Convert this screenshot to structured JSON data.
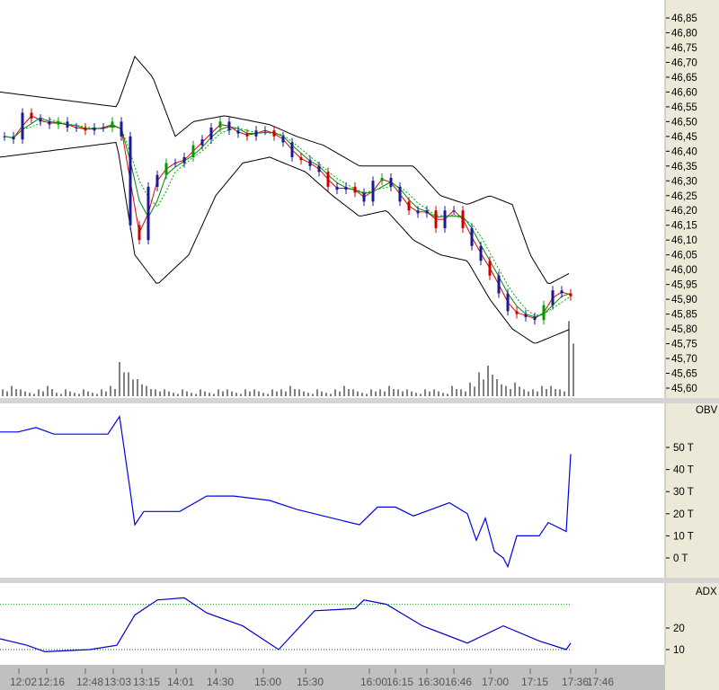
{
  "chart_data": [
    {
      "panel": "price",
      "type": "candlestick",
      "ylim": [
        45.57,
        46.88
      ],
      "y_ticks": [
        "46,85",
        "46,80",
        "46,75",
        "46,70",
        "46,65",
        "46,60",
        "46,55",
        "46,50",
        "46,45",
        "46,40",
        "46,35",
        "46,30",
        "46,25",
        "46,20",
        "46,15",
        "46,10",
        "46,05",
        "46,00",
        "45,95",
        "45,90",
        "45,85",
        "45,80",
        "45,75",
        "45,70",
        "45,65",
        "45,60"
      ],
      "y_tick_values": [
        46.85,
        46.8,
        46.75,
        46.7,
        46.65,
        46.6,
        46.55,
        46.5,
        46.45,
        46.4,
        46.35,
        46.3,
        46.25,
        46.2,
        46.15,
        46.1,
        46.05,
        46.0,
        45.95,
        45.9,
        45.85,
        45.8,
        45.75,
        45.7,
        45.65,
        45.6
      ],
      "closes": [
        46.45,
        46.44,
        46.53,
        46.51,
        46.5,
        46.49,
        46.5,
        46.48,
        46.48,
        46.47,
        46.48,
        46.48,
        46.5,
        46.45,
        46.15,
        46.1,
        46.28,
        46.32,
        46.36,
        46.36,
        46.38,
        46.42,
        46.44,
        46.48,
        46.5,
        46.47,
        46.46,
        46.45,
        46.47,
        46.47,
        46.45,
        46.43,
        46.38,
        46.37,
        46.35,
        46.33,
        46.28,
        46.27,
        46.28,
        46.26,
        46.23,
        46.3,
        46.31,
        46.28,
        46.23,
        46.2,
        46.19,
        46.2,
        46.14,
        46.2,
        46.2,
        46.14,
        46.08,
        46.03,
        45.98,
        45.92,
        45.86,
        45.85,
        45.84,
        45.83,
        45.88,
        45.93,
        45.92,
        45.91
      ],
      "bollinger_upper": [
        [
          0,
          46.6
        ],
        [
          130,
          46.55
        ],
        [
          150,
          46.72
        ],
        [
          170,
          46.65
        ],
        [
          195,
          46.45
        ],
        [
          215,
          46.5
        ],
        [
          250,
          46.52
        ],
        [
          300,
          46.49
        ],
        [
          330,
          46.45
        ],
        [
          360,
          46.42
        ],
        [
          400,
          46.35
        ],
        [
          430,
          46.35
        ],
        [
          460,
          46.35
        ],
        [
          490,
          46.25
        ],
        [
          520,
          46.22
        ],
        [
          545,
          46.25
        ],
        [
          570,
          46.22
        ],
        [
          590,
          46.05
        ],
        [
          610,
          45.95
        ],
        [
          635,
          45.99
        ]
      ],
      "bollinger_lower": [
        [
          0,
          46.38
        ],
        [
          130,
          46.43
        ],
        [
          150,
          46.05
        ],
        [
          175,
          45.95
        ],
        [
          210,
          46.05
        ],
        [
          240,
          46.25
        ],
        [
          270,
          46.36
        ],
        [
          300,
          46.38
        ],
        [
          340,
          46.33
        ],
        [
          370,
          46.25
        ],
        [
          400,
          46.18
        ],
        [
          430,
          46.2
        ],
        [
          460,
          46.1
        ],
        [
          490,
          46.05
        ],
        [
          520,
          46.03
        ],
        [
          545,
          45.9
        ],
        [
          570,
          45.8
        ],
        [
          595,
          45.75
        ],
        [
          635,
          45.8
        ]
      ],
      "volume": [
        2,
        3,
        2,
        1,
        2,
        3,
        1,
        2,
        1,
        2,
        1,
        2,
        3,
        10,
        7,
        5,
        3,
        2,
        2,
        1,
        2,
        1,
        2,
        1,
        2,
        2,
        1,
        2,
        2,
        1,
        2,
        2,
        3,
        2,
        1,
        2,
        1,
        2,
        3,
        2,
        1,
        2,
        2,
        3,
        2,
        2,
        1,
        2,
        2,
        1,
        3,
        2,
        4,
        7,
        9,
        5,
        3,
        4,
        2,
        2,
        3,
        3,
        2,
        22
      ],
      "colors": {
        "candle_up": "#009900",
        "candle_down": "#cc0000",
        "candle_neutral": "#1a1a99",
        "band": "#000000",
        "ma_fast": "#e00000",
        "ma_mid": "#008800",
        "ma_slow": "#00aa00",
        "volume": "#808080"
      }
    },
    {
      "panel": "OBV",
      "type": "line",
      "label": "OBV",
      "ylim": [
        -10,
        65
      ],
      "y_ticks": [
        "50 T",
        "40 T",
        "30 T",
        "20 T",
        "10 T",
        "0 T"
      ],
      "y_tick_values": [
        50,
        40,
        30,
        20,
        10,
        0
      ],
      "unit": "T",
      "points": [
        [
          0,
          57
        ],
        [
          20,
          57
        ],
        [
          40,
          59
        ],
        [
          60,
          56
        ],
        [
          120,
          56
        ],
        [
          133,
          64
        ],
        [
          145,
          30
        ],
        [
          150,
          15
        ],
        [
          160,
          21
        ],
        [
          200,
          21
        ],
        [
          230,
          28
        ],
        [
          260,
          28
        ],
        [
          300,
          26
        ],
        [
          330,
          22
        ],
        [
          360,
          19
        ],
        [
          400,
          15
        ],
        [
          420,
          23
        ],
        [
          440,
          23
        ],
        [
          460,
          19
        ],
        [
          500,
          25
        ],
        [
          520,
          20
        ],
        [
          530,
          8
        ],
        [
          540,
          18
        ],
        [
          550,
          3
        ],
        [
          560,
          0
        ],
        [
          565,
          -4
        ],
        [
          575,
          10
        ],
        [
          600,
          10
        ],
        [
          610,
          16
        ],
        [
          630,
          12
        ],
        [
          635,
          47
        ]
      ],
      "color": "#0000ee"
    },
    {
      "panel": "ADX",
      "type": "line",
      "label": "ADX",
      "ylim": [
        6,
        37
      ],
      "y_ticks": [
        "20",
        "10"
      ],
      "y_tick_values": [
        20,
        10
      ],
      "reference_lines": [
        31,
        10
      ],
      "points": [
        [
          0,
          15
        ],
        [
          30,
          12
        ],
        [
          50,
          9
        ],
        [
          100,
          10
        ],
        [
          130,
          12
        ],
        [
          150,
          26
        ],
        [
          175,
          33
        ],
        [
          205,
          34
        ],
        [
          230,
          27
        ],
        [
          270,
          21
        ],
        [
          310,
          10
        ],
        [
          350,
          28
        ],
        [
          395,
          29
        ],
        [
          405,
          33
        ],
        [
          430,
          31
        ],
        [
          470,
          21
        ],
        [
          520,
          13
        ],
        [
          560,
          21
        ],
        [
          600,
          14
        ],
        [
          630,
          10
        ],
        [
          635,
          13
        ]
      ],
      "color": "#0000cc"
    }
  ],
  "time_axis": {
    "labels": [
      "12:02",
      "12:16",
      "12:48",
      "13:03",
      "13:15",
      "14:01",
      "14:30",
      "15:00",
      "15:30",
      "16:00",
      "16:15",
      "16:30",
      "16:46",
      "17:00",
      "17:15",
      "17:36",
      "17:46"
    ]
  }
}
